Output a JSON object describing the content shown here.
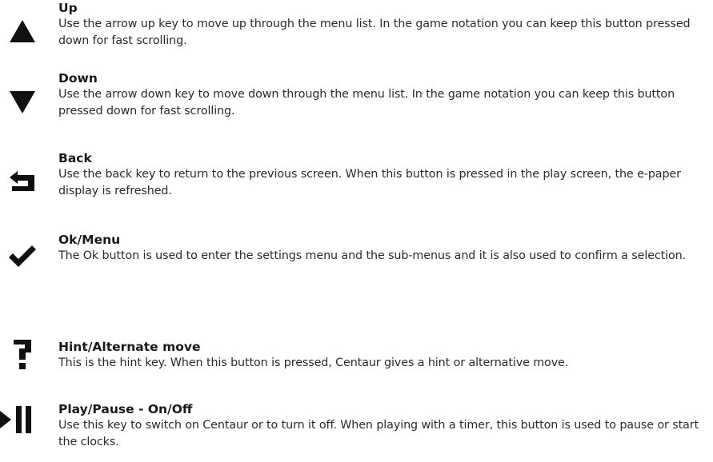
{
  "entries": [
    {
      "icon": "triangle-up-icon",
      "title": "Up",
      "description": "Use the arrow up key to move up through the menu list. In the game notation you can keep this button pressed down for fast scrolling."
    },
    {
      "icon": "triangle-down-icon",
      "title": "Down",
      "description": "Use the arrow down key to move down through the menu list. In the game notation you can keep this button pressed down for fast scrolling."
    },
    {
      "icon": "back-arrow-icon",
      "title": "Back",
      "description": "Use the back key to return to the previous screen. When this button is pressed in the play screen, the e-paper display is refreshed."
    },
    {
      "icon": "checkmark-icon",
      "title": "Ok/Menu",
      "description": "The Ok button is used to enter the settings menu and the sub-menus and it is also used to confirm a selection."
    },
    {
      "icon": "question-mark-icon",
      "title": "Hint/Alternate move",
      "description": "This is the hint key. When this button is pressed, Centaur gives a hint or alternative move."
    },
    {
      "icon": "play-pause-icon",
      "title": "Play/Pause - On/Off",
      "description": "Use this key to switch on Centaur or to turn it off. When playing with a timer, this button is used to pause or start the clocks."
    }
  ],
  "colors": {
    "text": "#1a1a1a",
    "icon": "#111111"
  }
}
